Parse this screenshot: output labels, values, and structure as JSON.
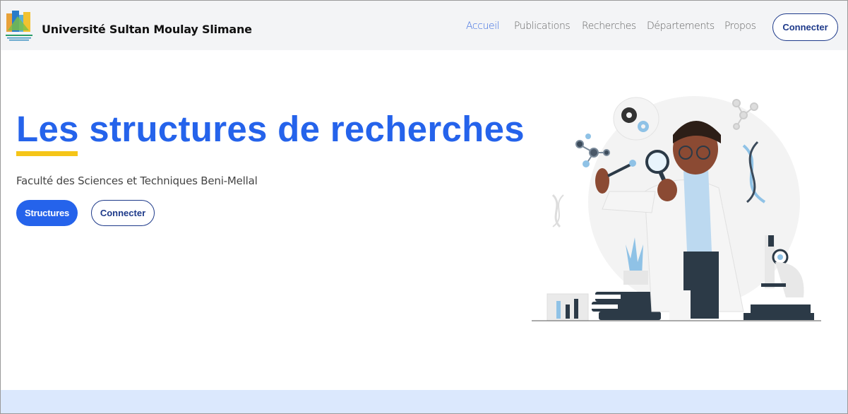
{
  "header": {
    "logo": "university-logo",
    "brand_name": "Université Sultan Moulay Slimane",
    "nav": [
      {
        "label": "Accueil",
        "active": true
      },
      {
        "label": "Publications",
        "active": false
      },
      {
        "label": "Recherches",
        "active": false
      },
      {
        "label": "Départements",
        "active": false
      },
      {
        "label": "Propos",
        "active": false
      }
    ],
    "connect_label": "Connecter"
  },
  "hero": {
    "title": "Les structures de recherches",
    "subtitle": "Faculté des Sciences et Techniques Beni-Mellal",
    "primary_button": "Structures",
    "secondary_button": "Connecter",
    "illustration": "scientist-with-magnifying-glass-illustration"
  },
  "colors": {
    "primary": "#2563eb",
    "accent_yellow": "#f5c518",
    "navy": "#1e3a8a",
    "header_bg": "#f3f4f6",
    "footer_band": "#dbe8fd"
  }
}
